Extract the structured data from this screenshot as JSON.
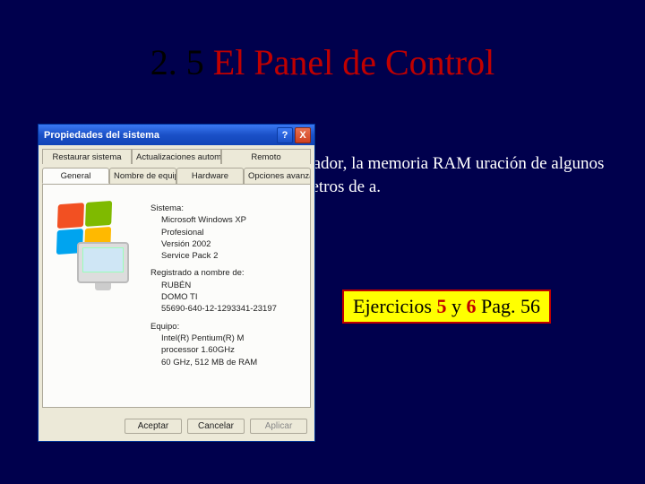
{
  "title": {
    "prefix": "2. 5 ",
    "main": "El Panel de Control"
  },
  "body_text": "procesador, la memoria RAM uración de algunos parámetros de a.",
  "callout": {
    "word1": "Ejercicios",
    "nums": "5",
    "and": "y",
    "nums2": "6",
    "tail": "Pag. 56"
  },
  "dialog": {
    "titlebar": "Propiedades del sistema",
    "help": "?",
    "close": "X",
    "tabs_row1": [
      "Restaurar sistema",
      "Actualizaciones automáticas",
      "Remoto"
    ],
    "tabs_row2": [
      "General",
      "Nombre de equipo",
      "Hardware",
      "Opciones avanzadas"
    ],
    "active_tab": "General",
    "info": {
      "system_label": "Sistema:",
      "system_lines": [
        "Microsoft Windows XP",
        "Profesional",
        "Versión 2002",
        "Service Pack 2"
      ],
      "registered_label": "Registrado a nombre de:",
      "registered_lines": [
        "RUBÉN",
        "DOMO TI",
        "55690-640-12-1293341-23197"
      ],
      "equipment_label": "Equipo:",
      "equipment_lines": [
        "Intel(R) Pentium(R) M",
        "processor 1.60GHz",
        "60 GHz, 512 MB de RAM"
      ]
    },
    "buttons": {
      "ok": "Aceptar",
      "cancel": "Cancelar",
      "apply": "Aplicar"
    }
  }
}
